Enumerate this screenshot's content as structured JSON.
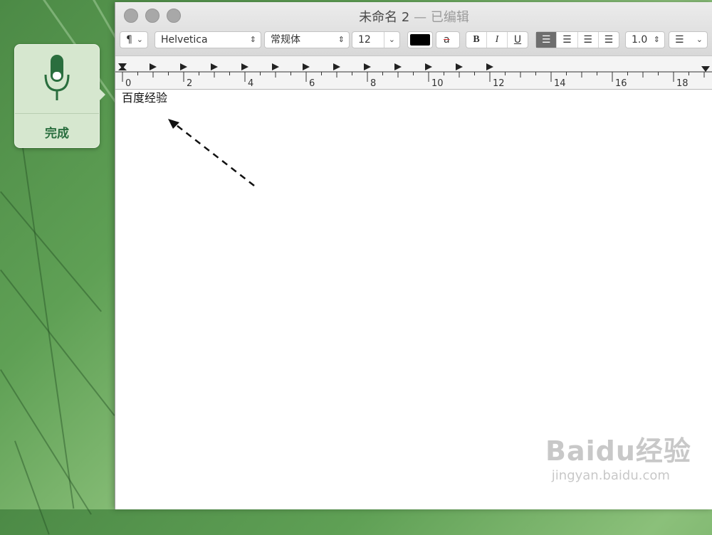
{
  "dictation": {
    "done_label": "完成",
    "icon": "microphone-icon",
    "accent": "#2a6e3e"
  },
  "window": {
    "title": "未命名 2",
    "separator": "—",
    "status": "已编辑"
  },
  "toolbar": {
    "paragraph_label": "¶",
    "font_family": "Helvetica",
    "font_style": "常规体",
    "font_size": "12",
    "text_color": "#000000",
    "highlight_label": "a",
    "bold": "B",
    "italic": "I",
    "underline": "U",
    "line_spacing": "1.0",
    "list_icon": "list-bullets-icon"
  },
  "ruler": {
    "labels": [
      "0",
      "2",
      "4",
      "6",
      "8",
      "10",
      "12",
      "14",
      "16",
      "18"
    ]
  },
  "document": {
    "text": "百度经验"
  },
  "watermark": {
    "brand": "Baidu经验",
    "url": "jingyan.baidu.com"
  }
}
